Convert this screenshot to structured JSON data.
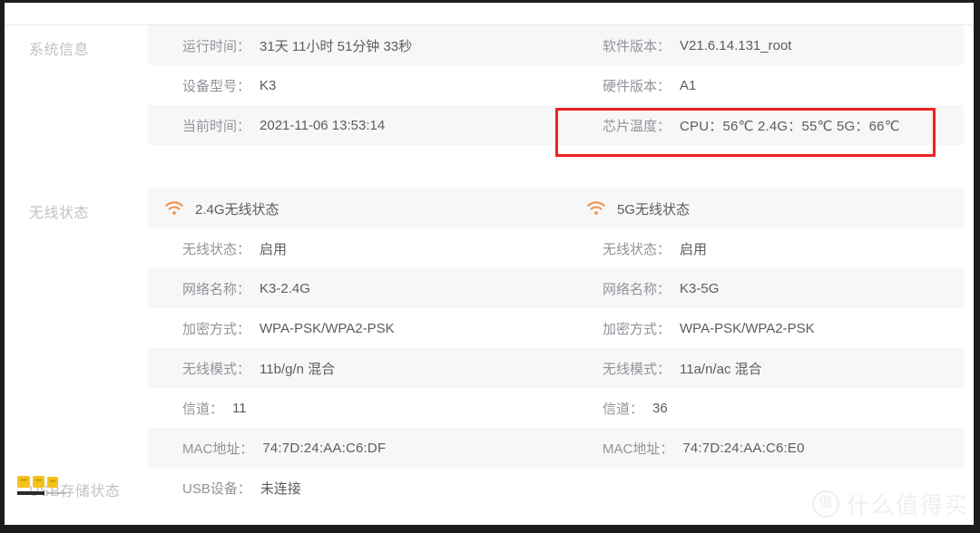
{
  "sections": {
    "system": {
      "label": "系统信息",
      "rows": [
        {
          "left": {
            "label": "运行时间：",
            "value": "31天 11小时 51分钟 33秒"
          },
          "right": {
            "label": "软件版本：",
            "value": "V21.6.14.131_root"
          }
        },
        {
          "left": {
            "label": "设备型号：",
            "value": "K3"
          },
          "right": {
            "label": "硬件版本：",
            "value": "A1"
          }
        },
        {
          "left": {
            "label": "当前时间：",
            "value": "2021-11-06 13:53:14"
          },
          "right": {
            "label": "芯片温度：",
            "value": "CPU：56℃   2.4G：55℃   5G：66℃"
          }
        }
      ]
    },
    "wireless": {
      "label": "无线状态",
      "headers": {
        "band24": {
          "icon": "wifi-icon",
          "title": "2.4G无线状态"
        },
        "band5": {
          "icon": "wifi-icon",
          "title": "5G无线状态"
        }
      },
      "rows": [
        {
          "left": {
            "label": "无线状态：",
            "value": "启用"
          },
          "right": {
            "label": "无线状态：",
            "value": "启用"
          }
        },
        {
          "left": {
            "label": "网络名称：",
            "value": "K3-2.4G"
          },
          "right": {
            "label": "网络名称：",
            "value": "K3-5G"
          }
        },
        {
          "left": {
            "label": "加密方式：",
            "value": "WPA-PSK/WPA2-PSK"
          },
          "right": {
            "label": "加密方式：",
            "value": "WPA-PSK/WPA2-PSK"
          }
        },
        {
          "left": {
            "label": "无线模式：",
            "value": "11b/g/n 混合"
          },
          "right": {
            "label": "无线模式：",
            "value": "11a/n/ac 混合"
          }
        },
        {
          "left": {
            "label": "信道：",
            "value": "11"
          },
          "right": {
            "label": "信道：",
            "value": "36"
          }
        },
        {
          "left": {
            "label": "MAC地址：",
            "value": "74:7D:24:AA:C6:DF"
          },
          "right": {
            "label": "MAC地址：",
            "value": "74:7D:24:AA:C6:E0"
          }
        }
      ]
    },
    "usb": {
      "label": "USB存储状态",
      "rows": [
        {
          "left": {
            "label": "USB设备：",
            "value": "未连接"
          },
          "right": {
            "label": "",
            "value": ""
          }
        }
      ]
    }
  },
  "highlight": {
    "name": "chip-temperature-highlight",
    "color": "#ee2222"
  },
  "watermarks": {
    "left": {
      "name": "brand-logo-watermark"
    },
    "right": {
      "badge": "值",
      "text": "什么值得买"
    }
  },
  "colors": {
    "accent_wifi": "#f2904a",
    "stripe": "#f7f7f8",
    "label_text": "#909399",
    "value_text": "#5a5c61",
    "section_label": "#c2c2c2",
    "highlight": "#ee2222"
  }
}
